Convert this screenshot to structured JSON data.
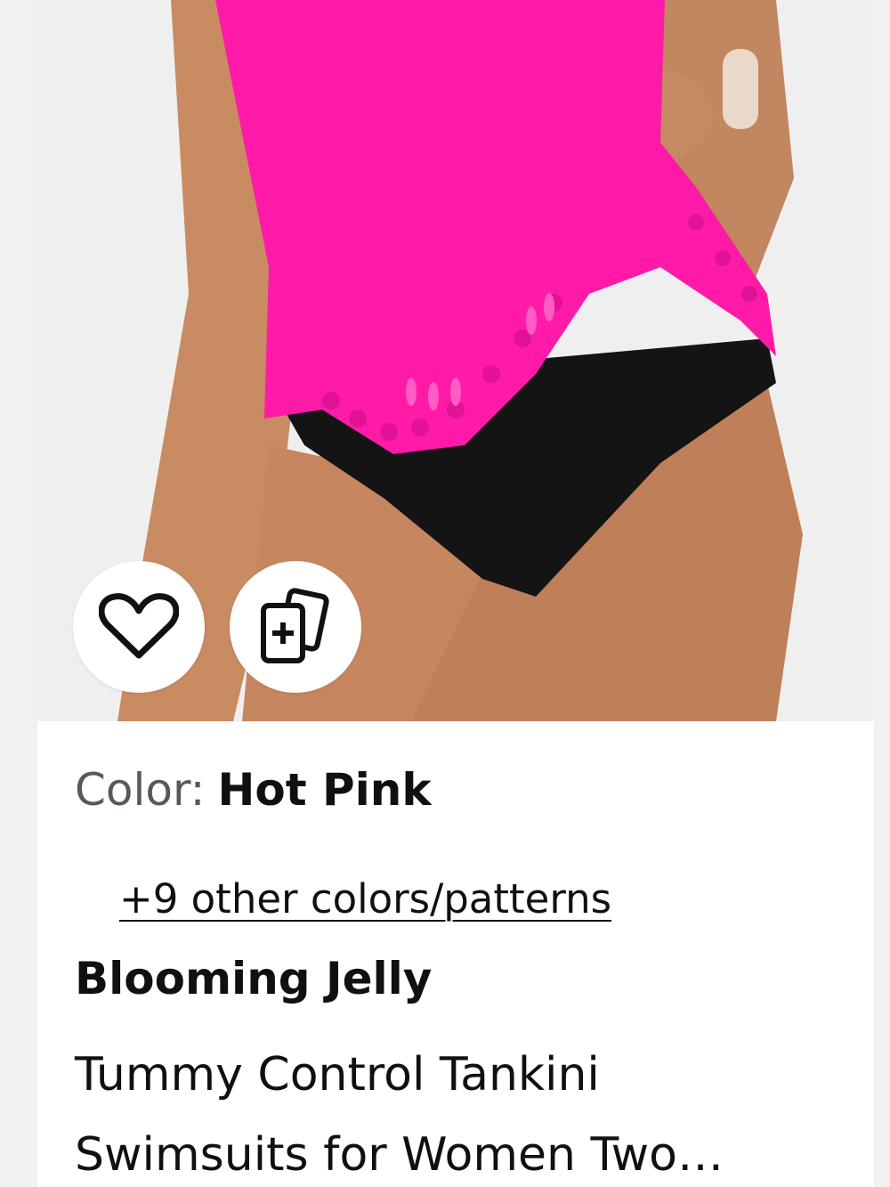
{
  "product": {
    "color_label": "Color:",
    "color_value": "Hot Pink",
    "other_colors_link": "+9 other colors/patterns",
    "brand": "Blooming Jelly",
    "title_line1": "Tummy Control Tankini",
    "title_line2": "Swimsuits for Women Two…"
  },
  "actions": {
    "wishlist_icon": "heart-icon",
    "add_to_collection_icon": "cards-plus-icon"
  },
  "colors": {
    "hot_pink": "#ff1aa8",
    "swim_bottom": "#141414",
    "text_primary": "#0f1111",
    "text_secondary": "#565959"
  }
}
